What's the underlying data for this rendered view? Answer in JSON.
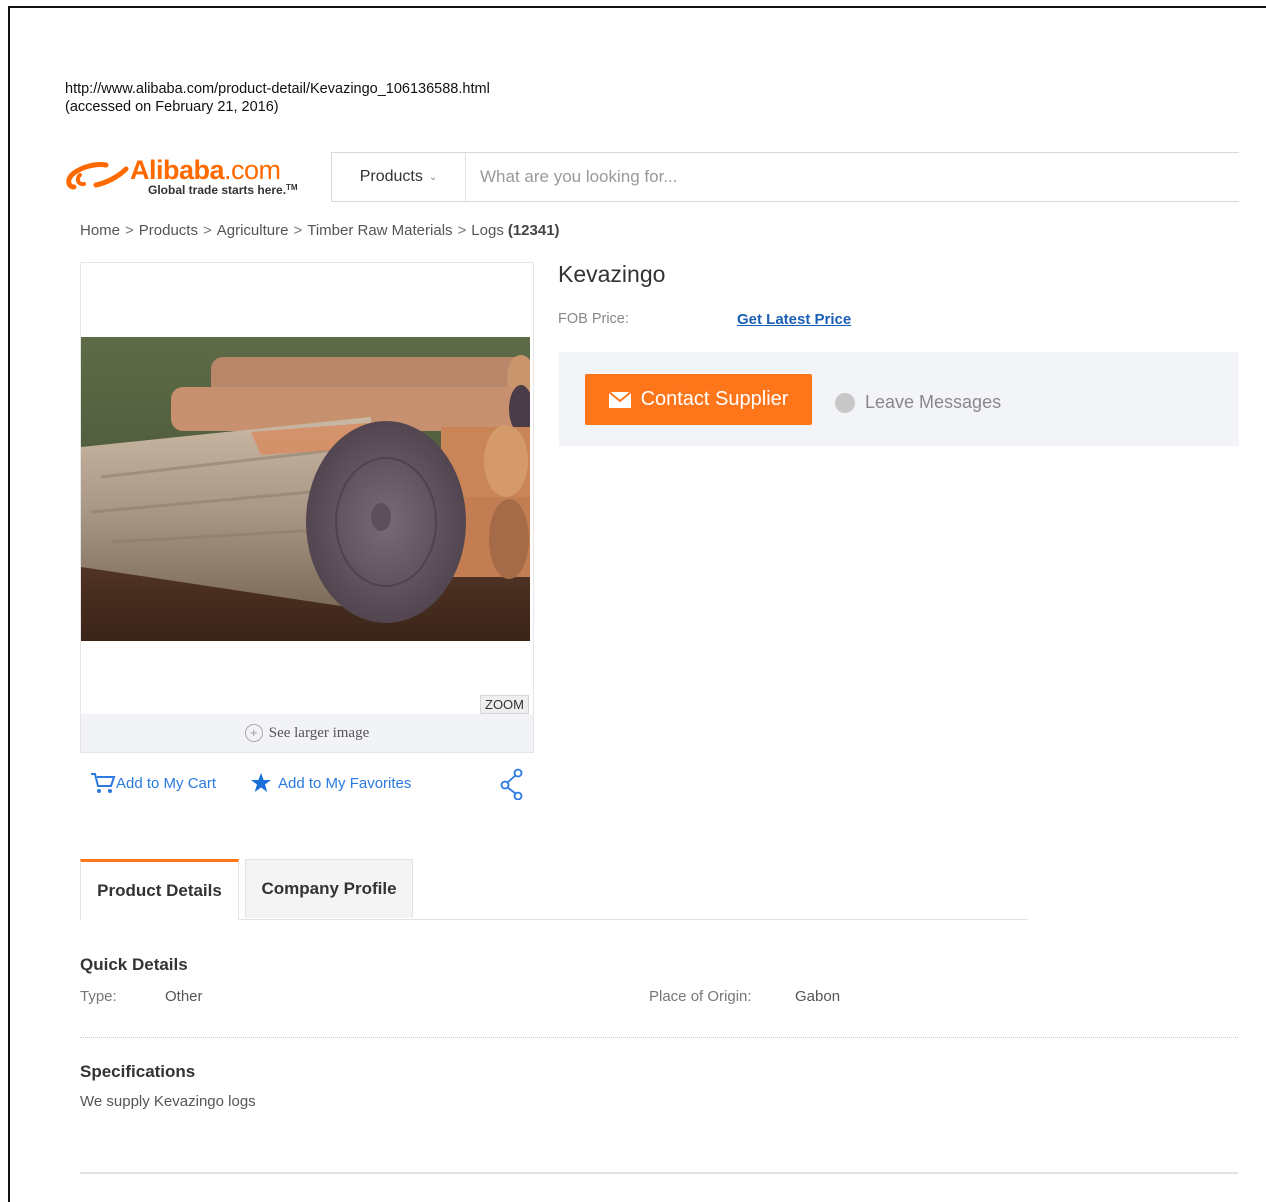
{
  "source": {
    "url": "http://www.alibaba.com/product-detail/Kevazingo_106136588.html",
    "accessed": "(accessed on February 21, 2016)"
  },
  "header": {
    "logo_text": "Alibaba",
    "logo_dotcom": ".com",
    "tagline": "Global trade starts here.",
    "tagline_tm": "TM",
    "search_category": "Products",
    "search_placeholder": "What are you looking for..."
  },
  "breadcrumb": {
    "items": [
      "Home",
      "Products",
      "Agriculture",
      "Timber Raw Materials",
      "Logs"
    ],
    "separator": ">",
    "count": "(12341)"
  },
  "gallery": {
    "zoom_label": "ZOOM",
    "larger_image_label": "See larger image"
  },
  "actions": {
    "cart_label": "Add to My Cart",
    "favorites_label": "Add to My Favorites"
  },
  "product": {
    "title": "Kevazingo",
    "fob_label": "FOB Price:",
    "fob_link": "Get Latest Price",
    "contact_button": "Contact Supplier",
    "leave_messages": "Leave Messages"
  },
  "tabs": [
    {
      "label": "Product Details"
    },
    {
      "label": "Company Profile"
    }
  ],
  "quick_details": {
    "title": "Quick Details",
    "type_label": "Type:",
    "type_value": "Other",
    "origin_label": "Place of Origin:",
    "origin_value": "Gabon"
  },
  "specifications": {
    "title": "Specifications",
    "text": "We supply Kevazingo logs"
  },
  "colors": {
    "brand_orange": "#ff6a00",
    "button_orange": "#ff7519",
    "link_blue": "#2a7ae2"
  }
}
